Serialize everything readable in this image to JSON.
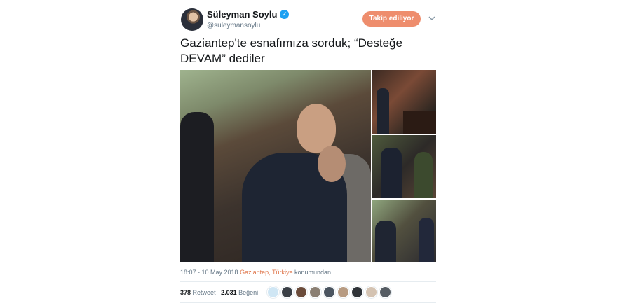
{
  "user": {
    "display_name": "Süleyman Soylu",
    "handle": "@suleymansoylu",
    "verified_icon": "verified-badge-icon"
  },
  "follow_button_label": "Takip ediliyor",
  "tweet_text": "Gaziantep'te esnafımıza sorduk; “Desteğe DEVAM” dediler",
  "meta": {
    "time": "18:07 - 10 May 2018",
    "city": "Gaziantep",
    "country": "Türkiye",
    "suffix": "konumundan"
  },
  "stats": {
    "retweets": "378",
    "retweets_label": "Retweet",
    "likes": "2.031",
    "likes_label": "Beğeni"
  },
  "colors": {
    "accent": "#e0794f",
    "follow_button": "#ee8d6d",
    "verified": "#1da1f2",
    "text": "#14171a",
    "muted": "#657786"
  },
  "liker_avatars": [
    "#cfe6f4",
    "#3a3f46",
    "#6a4b3a",
    "#8a7f73",
    "#4b5560",
    "#b79b82",
    "#2f3338",
    "#d4c3b2",
    "#555c63"
  ]
}
